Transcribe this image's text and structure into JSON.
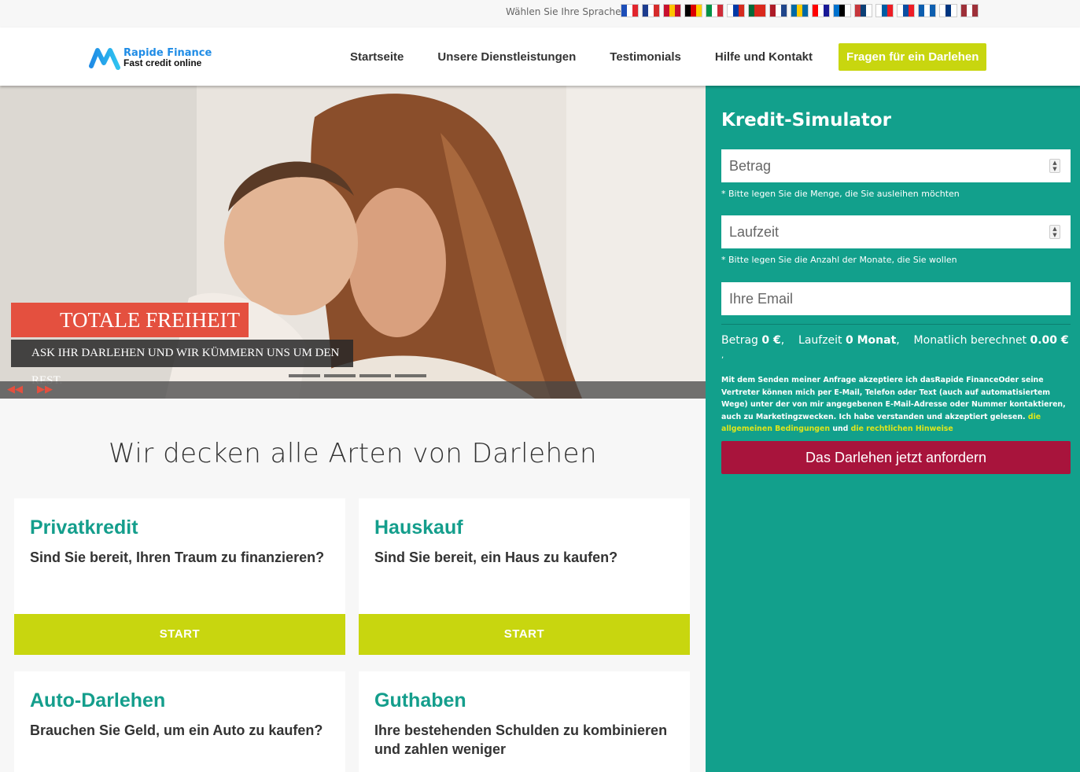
{
  "language": {
    "label": "Wählen Sie Ihre Sprache",
    "flags": [
      {
        "icon": "flag-fr-icon",
        "colors": [
          "#1d4eb8",
          "#ffffff",
          "#e1252d"
        ]
      },
      {
        "icon": "flag-gb-icon",
        "colors": [
          "#1d3c8e",
          "#ffffff",
          "#d52b2b"
        ]
      },
      {
        "icon": "flag-es-icon",
        "colors": [
          "#c8102e",
          "#ffc400",
          "#c8102e"
        ]
      },
      {
        "icon": "flag-de-icon",
        "colors": [
          "#000000",
          "#dd0000",
          "#ffce00"
        ]
      },
      {
        "icon": "flag-it-icon",
        "colors": [
          "#009246",
          "#ffffff",
          "#ce2b37"
        ]
      },
      {
        "icon": "flag-ru-icon",
        "colors": [
          "#ffffff",
          "#0039a6",
          "#d52b1e"
        ]
      },
      {
        "icon": "flag-pt-icon",
        "colors": [
          "#046a38",
          "#da291c",
          "#da291c"
        ]
      },
      {
        "icon": "flag-nl-icon",
        "colors": [
          "#ae1c28",
          "#ffffff",
          "#21468b"
        ]
      },
      {
        "icon": "flag-se-icon",
        "colors": [
          "#006aa7",
          "#fecc00",
          "#006aa7"
        ]
      },
      {
        "icon": "flag-hr-icon",
        "colors": [
          "#ff0000",
          "#ffffff",
          "#171796"
        ]
      },
      {
        "icon": "flag-ee-icon",
        "colors": [
          "#0072ce",
          "#000000",
          "#ffffff"
        ]
      },
      {
        "icon": "flag-rs-icon",
        "colors": [
          "#c6363c",
          "#0c4076",
          "#ffffff"
        ]
      },
      {
        "icon": "flag-si-icon",
        "colors": [
          "#ffffff",
          "#005da4",
          "#ed1c24"
        ]
      },
      {
        "icon": "flag-sk-icon",
        "colors": [
          "#ffffff",
          "#0b4ea2",
          "#ee1c25"
        ]
      },
      {
        "icon": "flag-gr-icon",
        "colors": [
          "#0d5eaf",
          "#ffffff",
          "#0d5eaf"
        ]
      },
      {
        "icon": "flag-fi-icon",
        "colors": [
          "#ffffff",
          "#003580",
          "#ffffff"
        ]
      },
      {
        "icon": "flag-lv-icon",
        "colors": [
          "#9e3039",
          "#ffffff",
          "#9e3039"
        ]
      }
    ]
  },
  "header": {
    "brand_name": "Rapide Finance",
    "brand_tagline": "Fast credit online",
    "nav": [
      "Startseite",
      "Unsere Dienstleistungen",
      "Testimonials",
      "Hilfe und Kontakt"
    ],
    "cta": "Fragen für ein Darlehen"
  },
  "hero": {
    "title": "TOTALE FREIHEIT",
    "subtitle": "ASK IHR DARLEHEN UND WIR KÜMMERN UNS UM DEN REST.",
    "prev_icon": "rewind-icon",
    "next_icon": "fast-forward-icon"
  },
  "main": {
    "title": "Wir decken alle Arten von Darlehen",
    "cards": [
      {
        "title": "Privatkredit",
        "text": "Sind Sie bereit, Ihren Traum zu finanzieren?",
        "button": "START"
      },
      {
        "title": "Hauskauf",
        "text": "Sind Sie bereit, ein Haus zu kaufen?",
        "button": "START"
      },
      {
        "title": "Auto-Darlehen",
        "text": "Brauchen Sie Geld, um ein Auto zu kaufen?"
      },
      {
        "title": "Guthaben",
        "text": "Ihre bestehenden Schulden zu kombinieren und zahlen weniger"
      }
    ]
  },
  "simulator": {
    "title": "Kredit-Simulator",
    "amount_placeholder": "Betrag",
    "amount_hint": "* Bitte legen Sie die Menge, die Sie ausleihen möchten",
    "duration_placeholder": "Laufzeit",
    "duration_hint": "* Bitte legen Sie die Anzahl der Monate, die Sie wollen",
    "email_placeholder": "Ihre Email",
    "summary": {
      "amount_label": "Betrag",
      "amount_value": "0 €",
      "duration_label": "Laufzeit",
      "duration_value": "0 Monat",
      "monthly_label": "Monatlich berechnet",
      "monthly_value": "0.00 €"
    },
    "legal_text": "Mit dem Senden meiner Anfrage akzeptiere ich dasRapide FinanceOder seine Vertreter können mich per E-Mail, Telefon oder Text (auch auf automatisiertem Wege) unter der von mir angegebenen E-Mail-Adresse oder Nummer kontaktieren, auch zu Marketingzwecken. Ich habe verstanden und akzeptiert gelesen.",
    "legal_link1": "die allgemeinen Bedingungen",
    "legal_and": "und",
    "legal_link2": "die rechtlichen Hinweise",
    "submit": "Das Darlehen jetzt anfordern"
  },
  "colors": {
    "teal": "#12a08c",
    "lime": "#c8d60f",
    "coral": "#e4503f",
    "crimson": "#a8143c",
    "brand_blue": "#1f8ce6"
  }
}
